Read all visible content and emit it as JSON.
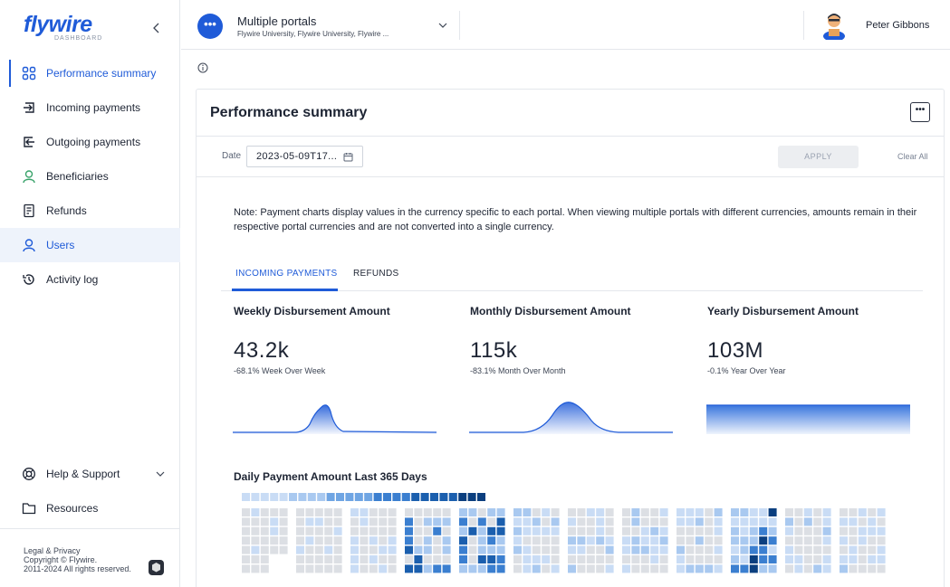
{
  "app": {
    "logo": "flywire",
    "logo_sub": "DASHBOARD"
  },
  "sidebar": {
    "items": [
      {
        "label": "Performance summary",
        "icon": "grid-icon",
        "state": "active"
      },
      {
        "label": "Incoming payments",
        "icon": "incoming-arrow-icon",
        "state": "normal"
      },
      {
        "label": "Outgoing payments",
        "icon": "outgoing-arrow-icon",
        "state": "normal"
      },
      {
        "label": "Beneficiaries",
        "icon": "person-icon",
        "state": "normal"
      },
      {
        "label": "Refunds",
        "icon": "refund-icon",
        "state": "normal"
      },
      {
        "label": "Users",
        "icon": "user-icon",
        "state": "hover"
      },
      {
        "label": "Activity log",
        "icon": "history-icon",
        "state": "normal"
      }
    ],
    "bottom": [
      {
        "label": "Help & Support",
        "icon": "lifebuoy-icon"
      },
      {
        "label": "Resources",
        "icon": "folder-icon"
      }
    ],
    "legal": {
      "line1": "Legal & Privacy",
      "line2": "Copyright © Flywire.",
      "line3": "2011-2024 All rights reserved."
    }
  },
  "topbar": {
    "portal_badge": "•••",
    "portal_title": "Multiple portals",
    "portal_subtitle": "Flywire University, Flywire University, Flywire ...",
    "user_name": "Peter Gibbons"
  },
  "card": {
    "title": "Performance summary",
    "menu": "•••",
    "date_label": "Date",
    "date_value": "2023-05-09T17...",
    "apply": "APPLY",
    "clear_all": "Clear All",
    "note": "Note: Payment charts display values in the currency specific to each portal. When viewing multiple portals with different currencies, amounts remain in their respective portal currencies and are not converted into a single currency.",
    "tabs": [
      {
        "label": "INCOMING PAYMENTS",
        "active": true
      },
      {
        "label": "REFUNDS",
        "active": false
      }
    ],
    "metrics": [
      {
        "title": "Weekly Disbursement Amount",
        "value": "43.2k",
        "change": "-68.1% Week Over Week"
      },
      {
        "title": "Monthly Disbursement Amount",
        "value": "115k",
        "change": "-83.1% Month Over Month"
      },
      {
        "title": "Yearly Disbursement Amount",
        "value": "103M",
        "change": "-0.1% Year Over Year"
      }
    ],
    "heatmap_title": "Daily Payment Amount Last 365 Days"
  },
  "colors": {
    "accent": "#1f5bd8",
    "heat_scale": [
      "#dcdfe4",
      "#c9dcf5",
      "#a9c9f0",
      "#6fa5e3",
      "#3b7fd0",
      "#1b5fae",
      "#0b3f7f"
    ]
  }
}
